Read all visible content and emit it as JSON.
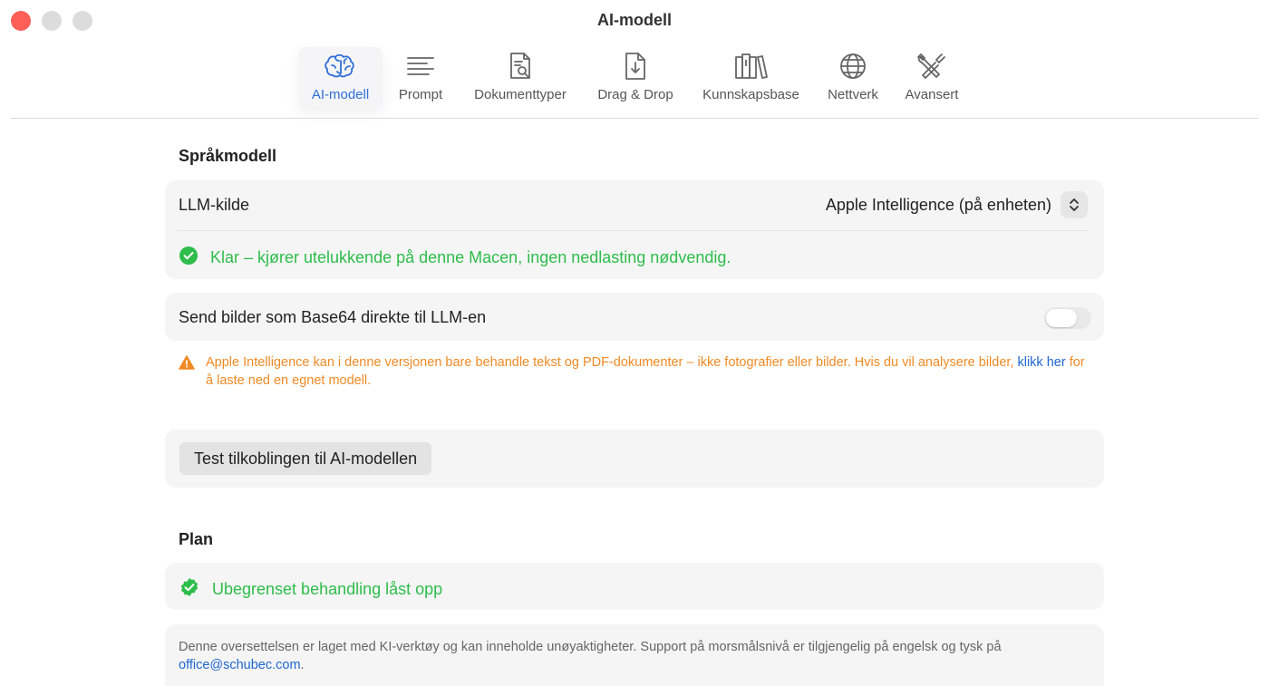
{
  "window": {
    "title": "AI-modell"
  },
  "toolbar": {
    "items": [
      {
        "label": "AI-modell",
        "icon": "brain-icon",
        "active": true
      },
      {
        "label": "Prompt",
        "icon": "text-lines-icon"
      },
      {
        "label": "Dokumenttyper",
        "icon": "document-search-icon"
      },
      {
        "label": "Drag & Drop",
        "icon": "document-download-icon"
      },
      {
        "label": "Kunnskapsbase",
        "icon": "books-icon"
      },
      {
        "label": "Nettverk",
        "icon": "globe-icon"
      },
      {
        "label": "Avansert",
        "icon": "tools-icon"
      }
    ]
  },
  "language_model": {
    "section_title": "Språkmodell",
    "llm_source_label": "LLM-kilde",
    "llm_source_value": "Apple Intelligence (på enheten)",
    "status_text": "Klar – kjører utelukkende på denne Macen, ingen nedlasting nødvendig.",
    "base64_label": "Send bilder som Base64 direkte til LLM-en",
    "base64_enabled": false,
    "warning_text_1": "Apple Intelligence kan i denne versjonen bare behandle tekst og PDF-dokumenter – ikke fotografier eller bilder. Hvis du vil analysere bilder, ",
    "warning_link": "klikk her",
    "warning_text_2": " for å laste ned en egnet modell.",
    "test_button": "Test tilkoblingen til AI-modellen"
  },
  "plan": {
    "section_title": "Plan",
    "status_text": "Ubegrenset behandling låst opp"
  },
  "footnote": {
    "text": "Denne oversettelsen er laget med KI-verktøy og kan inneholde unøyaktigheter. Support på morsmålsnivå er tilgjengelig på engelsk og tysk på ",
    "email": "office@schubec.com",
    "suffix": "."
  },
  "colors": {
    "accent": "#2f6fd8",
    "success": "#2ebd4b",
    "warning": "#f08a24",
    "link": "#1f66d1"
  }
}
